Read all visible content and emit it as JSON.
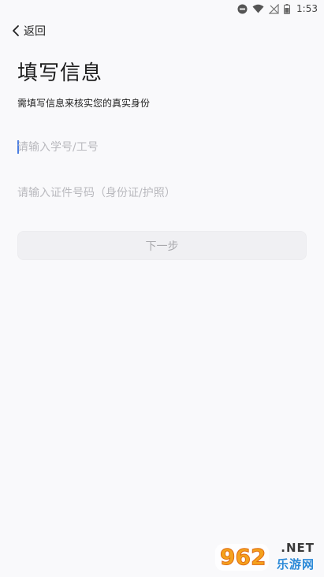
{
  "status_bar": {
    "time": "1:53",
    "icons": [
      "do-not-disturb-icon",
      "wifi-icon",
      "no-signal-icon",
      "battery-icon"
    ]
  },
  "nav": {
    "back_label": "返回"
  },
  "header": {
    "title": "填写信息",
    "subtitle": "需填写信息来核实您的真实身份"
  },
  "form": {
    "student_id": {
      "placeholder": "请输入学号/工号",
      "value": ""
    },
    "id_number": {
      "placeholder": "请输入证件号码（身份证/护照）",
      "value": ""
    },
    "next_label": "下一步"
  },
  "watermark": {
    "net": ".NET",
    "site": "乐游网",
    "brand_color": "#2c8ad8"
  }
}
